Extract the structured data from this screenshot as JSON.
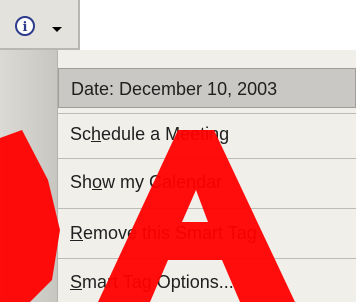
{
  "smart_tag": {
    "icon": "info-icon",
    "dropdown_icon": "chevron-down-icon",
    "icon_glyph": "i"
  },
  "menu": {
    "items": [
      {
        "prefix": "Date: December 10, 2003",
        "key": "",
        "suffix": "",
        "highlighted": true
      },
      {
        "prefix": "Sc",
        "key": "h",
        "suffix": "edule a Meeting",
        "highlighted": false
      },
      {
        "prefix": "Sh",
        "key": "o",
        "suffix": "w my Calendar",
        "highlighted": false
      },
      {
        "prefix": "",
        "key": "R",
        "suffix": "emove this Smart Tag",
        "highlighted": false
      },
      {
        "prefix": "",
        "key": "S",
        "suffix": "mart Tag Options...",
        "highlighted": false
      }
    ]
  },
  "colors": {
    "highlight": "#c9c8c4",
    "menu_background": "#f0efea",
    "watermark_red": "#ff0000"
  }
}
